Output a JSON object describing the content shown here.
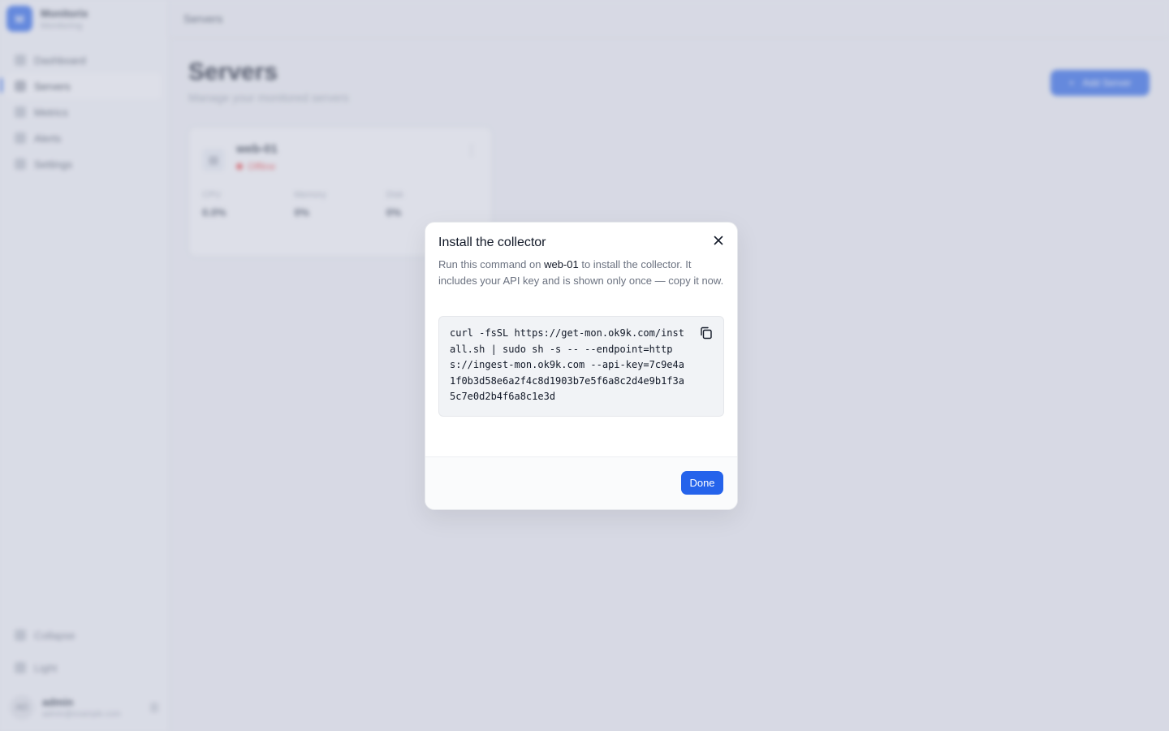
{
  "sidebar": {
    "brand": {
      "logo": "M",
      "name": "Monitorix",
      "subtitle": "Monitoring"
    },
    "items": [
      {
        "label": "Dashboard",
        "icon": "home-icon"
      },
      {
        "label": "Servers",
        "icon": "server-icon",
        "active": true
      },
      {
        "label": "Metrics",
        "icon": "chart-icon"
      },
      {
        "label": "Alerts",
        "icon": "bell-icon"
      },
      {
        "label": "Settings",
        "icon": "gear-icon"
      }
    ],
    "collapse_label": "Collapse",
    "theme_label": "Light",
    "user": {
      "initials": "AD",
      "name": "admin",
      "email": "admin@example.com"
    }
  },
  "topbar": {
    "breadcrumb": "Servers"
  },
  "page": {
    "title": "Servers",
    "subtitle": "Manage your monitored servers",
    "add_button": "Add Server"
  },
  "server_card": {
    "name": "web-01",
    "status": "Offline",
    "metrics": [
      {
        "label": "CPU",
        "value": "0.0%"
      },
      {
        "label": "Memory",
        "value": "0%"
      },
      {
        "label": "Disk",
        "value": "0%"
      }
    ]
  },
  "dialog": {
    "title": "Install the collector",
    "desc_before": "Run this command on ",
    "server_name": "web-01",
    "desc_after": " to install the collector. It includes your API key and is shown only once — copy it now.",
    "command": "curl -fsSL https://get-mon.ok9k.com/install.sh | sudo sh -s -- --endpoint=https://ingest-mon.ok9k.com --api-key=7c9e4a1f0b3d58e6a2f4c8d1903b7e5f6a8c2d4e9b1f3a5c7e0d2b4f6a8c1e3d",
    "done_label": "Done"
  },
  "colors": {
    "accent": "#2563eb",
    "danger": "#ef4444"
  }
}
